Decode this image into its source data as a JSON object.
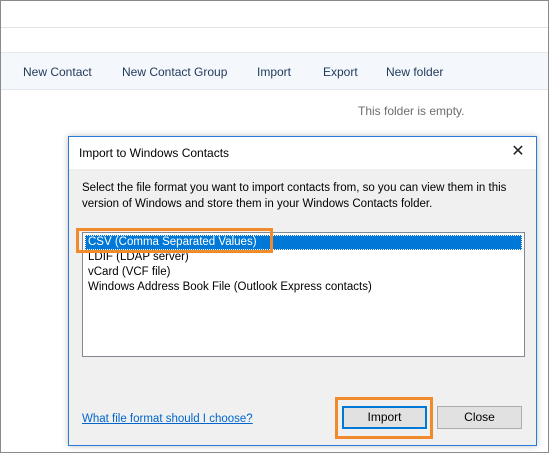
{
  "toolbar": {
    "items": [
      {
        "label": "New Contact"
      },
      {
        "label": "New Contact Group"
      },
      {
        "label": "Import"
      },
      {
        "label": "Export"
      },
      {
        "label": "New folder"
      }
    ]
  },
  "main": {
    "empty_message": "This folder is empty."
  },
  "dialog": {
    "title": "Import to Windows Contacts",
    "close_glyph": "✕",
    "description": "Select the file format you want to import contacts from, so you can view them in this version of Windows and store them in your Windows Contacts folder.",
    "formats": [
      {
        "label": "CSV (Comma Separated Values)",
        "selected": true
      },
      {
        "label": "LDIF (LDAP server)",
        "selected": false
      },
      {
        "label": "vCard (VCF file)",
        "selected": false
      },
      {
        "label": "Windows Address Book File (Outlook Express contacts)",
        "selected": false
      }
    ],
    "help_link": "What file format should I choose?",
    "import_button": "Import",
    "close_button": "Close"
  },
  "colors": {
    "selection": "#0078d7",
    "highlight": "#f08a2a",
    "link": "#0066cc"
  }
}
